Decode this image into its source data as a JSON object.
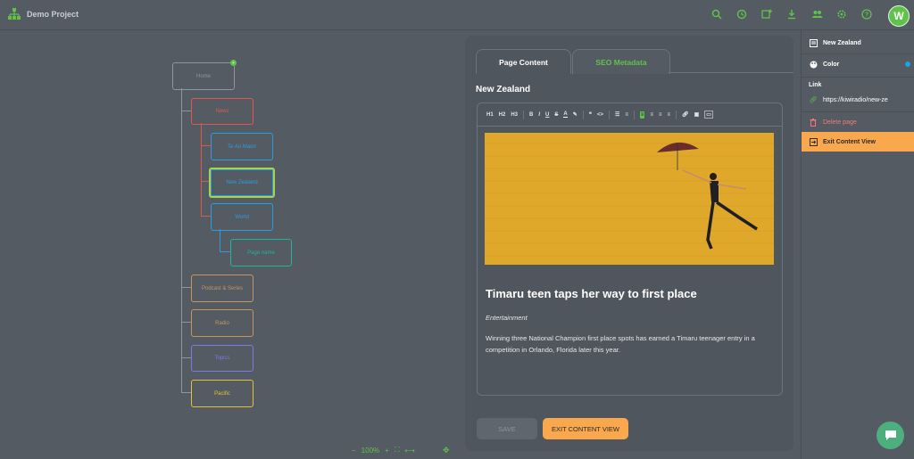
{
  "app": {
    "project_title": "Demo Project",
    "avatar_letter": "W",
    "accent_color": "#5fc24a",
    "toolbar_icons": [
      "search-icon",
      "history-icon",
      "add-page-icon",
      "download-icon",
      "users-icon",
      "settings-icon",
      "help-icon"
    ]
  },
  "tree": {
    "nodes": [
      {
        "name": "Home",
        "color": "#8a96a4"
      },
      {
        "name": "News",
        "color": "#e0584d"
      },
      {
        "name": "Te Ao Maori",
        "color": "#2a9de0"
      },
      {
        "name": "New Zealand",
        "color": "#2a9de0"
      },
      {
        "name": "World",
        "color": "#2a9de0"
      },
      {
        "name": "Page name",
        "color": "#1fb3a0"
      },
      {
        "name": "Podcast & Series",
        "color": "#c79560"
      },
      {
        "name": "Radio",
        "color": "#c79560"
      },
      {
        "name": "Topics",
        "color": "#7a79e6"
      },
      {
        "name": "Pacific",
        "color": "#e2c23a"
      }
    ],
    "badge": "+"
  },
  "zoom": {
    "minus": "−",
    "level": "100%",
    "plus": "+"
  },
  "editor": {
    "tabs": [
      {
        "label": "Page Content"
      },
      {
        "label": "SEO Metadata"
      }
    ],
    "page_heading": "New Zealand",
    "toolbar": [
      "H1",
      "H2",
      "H3",
      "B",
      "I",
      "U",
      "S",
      "A"
    ],
    "article": {
      "title": "Timaru teen taps her way to first place",
      "category": "Entertainment",
      "body": "Winning three National Champion first place spots has earned a Timaru teenager entry in a competition in Orlando, Florida later this year."
    },
    "save_label": "SAVE",
    "exit_label": "EXIT CONTENT VIEW"
  },
  "sidebar": {
    "page_name": "New Zealand",
    "color_label": "Color",
    "color_value": "#18a4e0",
    "link_heading": "Link",
    "link_url": "https://kiwiradio/new-ze",
    "delete_label": "Delete page",
    "exit_label": "Exit Content View"
  }
}
